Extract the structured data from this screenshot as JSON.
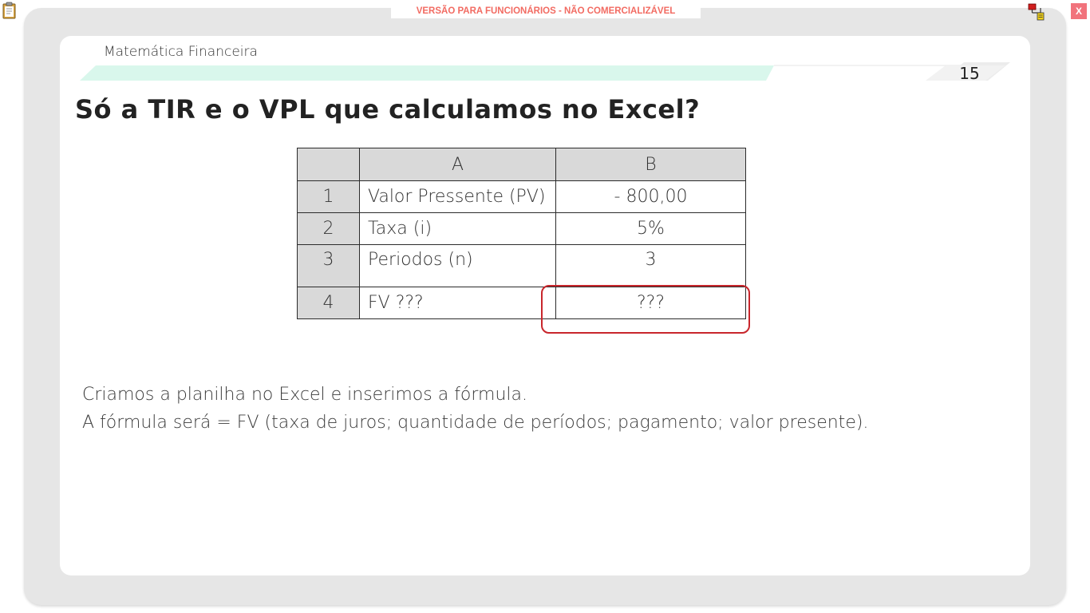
{
  "app": {
    "banner": "VERSÃO PARA FUNCIONÁRIOS - NÃO COMERCIALIZÁVEL",
    "close_label": "X",
    "icons": [
      "clipboard-icon",
      "network-icon"
    ]
  },
  "slide": {
    "course": "Matemática Financeira",
    "number": "15",
    "title": "Só a TIR e o VPL que calculamos no Excel?",
    "accent_color": "#d9f7ec",
    "highlight_color": "#c8262c"
  },
  "spreadsheet": {
    "columns": [
      "A",
      "B"
    ],
    "rows": [
      {
        "num": "1",
        "label": "Valor Pressente (PV)",
        "value": "- 800,00"
      },
      {
        "num": "2",
        "label": "Taxa (i)",
        "value": "5%"
      },
      {
        "num": "3",
        "label": "Periodos (n)",
        "value": "3"
      },
      {
        "num": "4",
        "label": "FV ???",
        "value": "???"
      }
    ]
  },
  "text": {
    "line1": "Criamos a planilha no Excel e inserimos a fórmula.",
    "line2": "A fórmula será = FV (taxa de juros; quantidade de períodos; pagamento; valor presente)."
  }
}
